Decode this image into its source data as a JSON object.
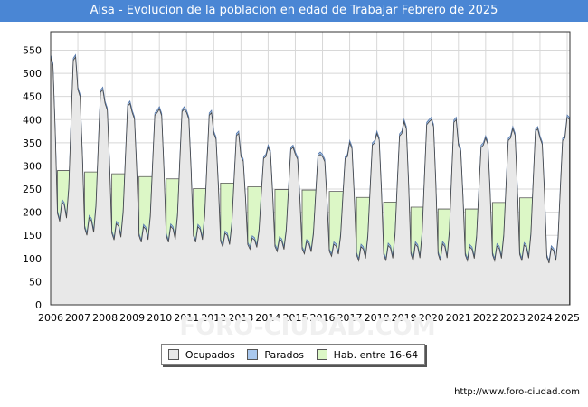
{
  "title": "Aisa - Evolucion de la poblacion en edad de Trabajar Febrero de 2025",
  "source": "http://www.foro-ciudad.com",
  "watermark": "FORO-CIUDAD.COM",
  "colors": {
    "title_bg": "#4a86d4",
    "ocupados": "#e8e8e8",
    "parados": "#a9c8ee",
    "hab": "#dcf7c6",
    "hab_line": "#555555",
    "grid": "#d8d8d8",
    "plot_bg": "#ffffff"
  },
  "legend": [
    {
      "label": "Ocupados",
      "color": "#e8e8e8"
    },
    {
      "label": "Parados",
      "color": "#a9c8ee"
    },
    {
      "label": "Hab. entre 16-64",
      "color": "#dcf7c6"
    }
  ],
  "chart_data": {
    "type": "area",
    "title": "Aisa - Evolucion de la poblacion en edad de Trabajar Febrero de 2025",
    "xlabel": "",
    "ylabel": "",
    "xlim": [
      2006,
      2025.1
    ],
    "ylim": [
      0,
      590
    ],
    "y_ticks": [
      0,
      50,
      100,
      150,
      200,
      250,
      300,
      350,
      400,
      450,
      500,
      550
    ],
    "x_ticks": [
      2006,
      2007,
      2008,
      2009,
      2010,
      2011,
      2012,
      2013,
      2014,
      2015,
      2016,
      2017,
      2018,
      2019,
      2020,
      2021,
      2022,
      2023,
      2024,
      2025
    ],
    "grid": true,
    "legend_position": "bottom",
    "hab_16_64": {
      "name": "Hab. entre 16-64",
      "years": [
        2006,
        2007,
        2008,
        2009,
        2010,
        2011,
        2012,
        2013,
        2014,
        2015,
        2016,
        2017,
        2018,
        2019,
        2020,
        2021,
        2022,
        2023,
        2024
      ],
      "values": [
        290,
        287,
        283,
        277,
        272,
        251,
        263,
        255,
        249,
        248,
        245,
        232,
        222,
        211,
        207,
        207,
        221,
        231,
        0
      ]
    },
    "seasonal_base": {
      "years": [
        2006,
        2007,
        2008,
        2009,
        2010,
        2011,
        2012,
        2013,
        2014,
        2015,
        2016,
        2017,
        2018,
        2019,
        2020,
        2021,
        2022,
        2023,
        2024
      ],
      "peak": [
        540,
        470,
        440,
        420,
        428,
        420,
        375,
        325,
        345,
        330,
        325,
        355,
        375,
        400,
        405,
        350,
        365,
        385,
        365
      ],
      "low": [
        185,
        155,
        145,
        140,
        140,
        140,
        130,
        125,
        120,
        115,
        110,
        100,
        100,
        100,
        100,
        100,
        100,
        100,
        95
      ]
    },
    "end_value": 410,
    "parados_offset": 5
  }
}
